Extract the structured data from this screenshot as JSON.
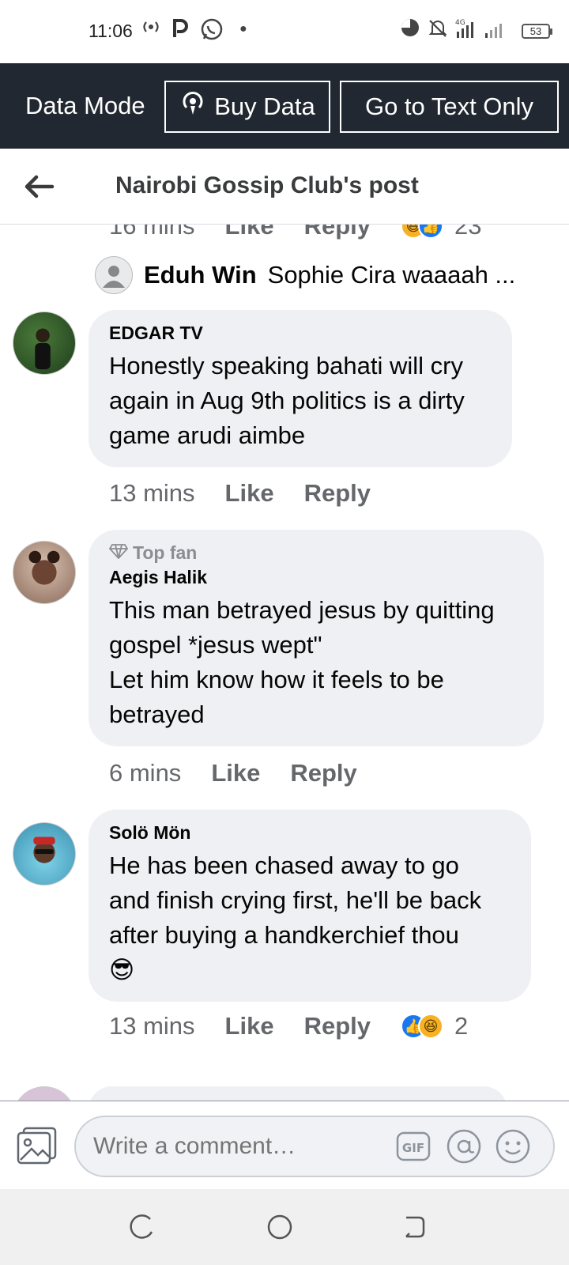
{
  "status_bar": {
    "time": "11:06",
    "battery": "53"
  },
  "data_bar": {
    "mode_label": "Data Mode",
    "buy_data_label": "Buy Data",
    "text_only_label": "Go to Text Only"
  },
  "header": {
    "title": "Nairobi Gossip Club's post"
  },
  "top_partial": {
    "time": "16 mins",
    "like": "Like",
    "reply": "Reply",
    "reaction_count": "23"
  },
  "reply_preview": {
    "name": "Eduh Win",
    "text": "Sophie Cira waaaah ..."
  },
  "comments": [
    {
      "author": "EDGAR TV",
      "lines": [
        "Honestly speaking bahati will cry",
        "again in Aug 9th politics is a dirty",
        "game arudi aimbe"
      ],
      "time": "13 mins",
      "like": "Like",
      "reply": "Reply"
    },
    {
      "badge": "Top fan",
      "author": "Aegis Halik",
      "lines": [
        "This man betrayed jesus by quitting",
        "gospel *jesus wept\"",
        "Let him know how it feels to be",
        "betrayed"
      ],
      "time": "6 mins",
      "like": "Like",
      "reply": "Reply"
    },
    {
      "author": "Solö Mön",
      "lines": [
        "He has been chased away to go",
        "and finish crying first, he'll be back",
        "after buying a handkerchief thou",
        "😎"
      ],
      "time": "13 mins",
      "like": "Like",
      "reply": "Reply",
      "reaction_count": "2"
    }
  ],
  "compose": {
    "placeholder": "Write a comment…",
    "gif_label": "GIF"
  },
  "colors": {
    "data_bar_bg": "#222831",
    "bubble_bg": "#eff0f3",
    "meta_text": "#65676b",
    "like_blue": "#1877f2",
    "haha_yellow": "#f7b125"
  }
}
